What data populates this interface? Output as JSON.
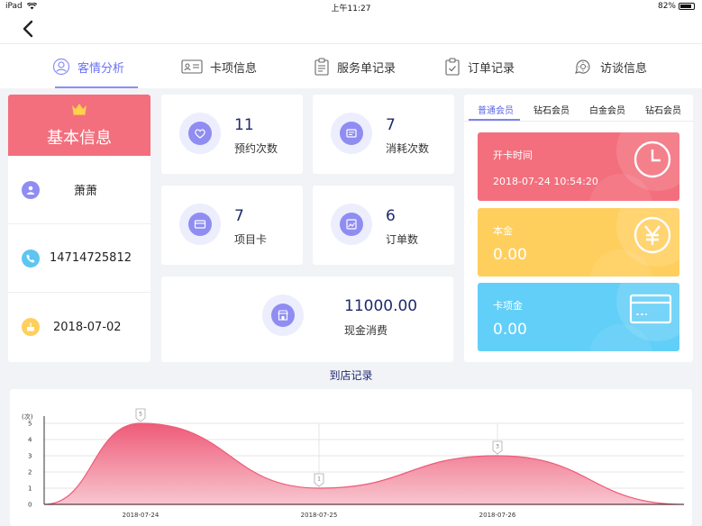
{
  "status_bar": {
    "device": "iPad",
    "time": "上午11:27",
    "battery": "82%"
  },
  "tabs": [
    {
      "label": "客情分析",
      "icon": "user-icon",
      "active": true
    },
    {
      "label": "卡项信息",
      "icon": "id-card-icon",
      "active": false
    },
    {
      "label": "服务单记录",
      "icon": "clipboard-icon",
      "active": false
    },
    {
      "label": "订单记录",
      "icon": "order-check-icon",
      "active": false
    },
    {
      "label": "访谈信息",
      "icon": "interview-icon",
      "active": false
    }
  ],
  "basic_info": {
    "title": "基本信息",
    "name": "萧萧",
    "phone": "14714725812",
    "birthday": "2018-07-02"
  },
  "stats": {
    "appointments": {
      "value": "11",
      "label": "预约次数"
    },
    "consumptions": {
      "value": "7",
      "label": "消耗次数"
    },
    "item_cards": {
      "value": "7",
      "label": "项目卡"
    },
    "orders": {
      "value": "6",
      "label": "订单数"
    },
    "cash": {
      "value": "11000.00",
      "label": "现金消费"
    }
  },
  "member": {
    "tabs": [
      "普通会员",
      "钻石会员",
      "白金会员",
      "钻石会员"
    ],
    "open_time": {
      "label": "开卡时间",
      "value": "2018-07-24 10:54:20",
      "color": "#f36f7d"
    },
    "principal": {
      "label": "本金",
      "value": "0.00",
      "color": "#ffcf5e"
    },
    "card_fund": {
      "label": "卡项金",
      "value": "0.00",
      "color": "#62cff8"
    }
  },
  "visit_section_title": "到店记录",
  "chart_data": {
    "type": "area",
    "x": [
      "2018-07-24",
      "2018-07-25",
      "2018-07-26"
    ],
    "series": [
      {
        "values": [
          5,
          1,
          3
        ]
      }
    ],
    "ylabel": "(次)",
    "ylim": [
      0,
      5
    ],
    "yticks": [
      0,
      1,
      2,
      3,
      4,
      5
    ],
    "data_labels": [
      "5",
      "1",
      "3"
    ],
    "grid": true,
    "color": "#f06a85"
  }
}
